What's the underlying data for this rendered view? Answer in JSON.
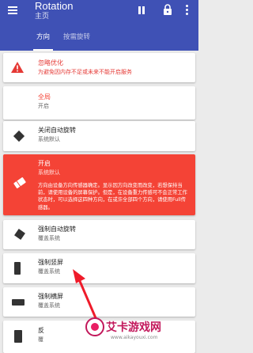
{
  "app_bar": {
    "title": "Rotation",
    "subtitle": "主页",
    "background": "#3f51b5"
  },
  "tabs": [
    {
      "label": "方向",
      "active": true
    },
    {
      "label": "按需旋转",
      "active": false
    }
  ],
  "cards": [
    {
      "id": "battery_optimization",
      "icon": "warning-icon",
      "title": "忽略优化",
      "subtitle": "为避免因内存不足或未来不能开启服务",
      "style": "warning"
    },
    {
      "id": "global",
      "icon": "none",
      "title": "全局",
      "subtitle": "开启",
      "style": "highlight"
    },
    {
      "id": "auto_rotate_off",
      "icon": "rotate-diamond-icon",
      "title": "关闭自动旋转",
      "subtitle": "系统默认"
    },
    {
      "id": "enabled",
      "icon": "eraser-icon",
      "title": "开启",
      "subtitle": "系统默认",
      "description": "方向由设备方向传感器确定。显示因方向改变而改变，若想保持当前，请使用设备的屏幕保护。但是，在设备重力传感可不会正常工作状态时，可以选择这四种方向，在或许全部四个方向，请使用Full传感器。",
      "style": "selected"
    },
    {
      "id": "force_auto_rotate",
      "icon": "rotate-square-icon",
      "title": "强制自动旋转",
      "subtitle": "覆盖系统"
    },
    {
      "id": "force_portrait",
      "icon": "portrait-icon",
      "title": "强制竖屏",
      "subtitle": "覆盖系统"
    },
    {
      "id": "force_landscape",
      "icon": "landscape-icon",
      "title": "强制横屏",
      "subtitle": "覆盖系统"
    },
    {
      "id": "reverse",
      "icon": "reverse-icon",
      "title": "反",
      "subtitle": "覆"
    }
  ],
  "watermark": {
    "text": "艾卡游戏网",
    "url": "www.aikayouxi.com"
  },
  "colors": {
    "accent_red": "#f44336",
    "warning_red": "#e53935",
    "annotation_red": "#ef1b2a"
  }
}
